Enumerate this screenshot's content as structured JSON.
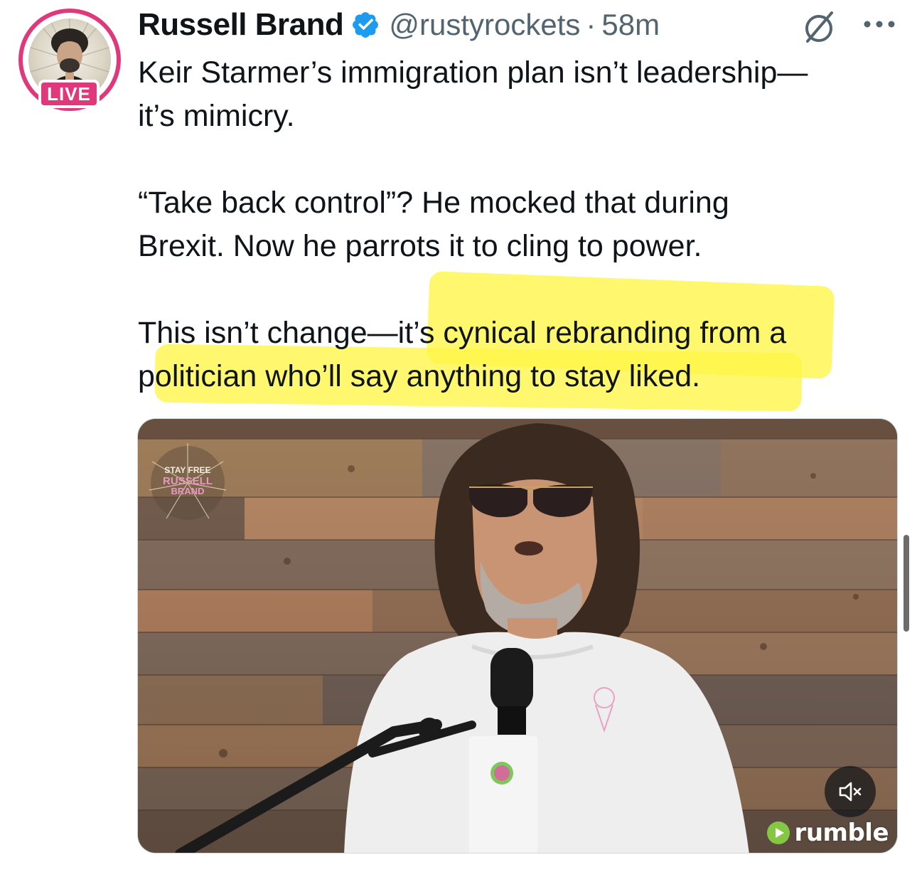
{
  "author": {
    "display_name": "Russell Brand",
    "handle": "@rustyrockets",
    "separator": "·",
    "time": "58m",
    "live_badge": "LIVE",
    "verified": true
  },
  "tweet": {
    "line1": "Keir Starmer’s immigration plan isn’t leadership—",
    "line2": "it’s mimicry.",
    "line3": "“Take back control”? He mocked that during",
    "line4": "Brexit. Now he parrots it to cling to power.",
    "line5": "This isn’t change—it’s cynical rebranding from a",
    "line6": "politician who’ll say anything to stay liked."
  },
  "media": {
    "type": "video",
    "logo_line1": "STAY FREE",
    "logo_line2": "RUSSELL",
    "logo_line3": "BRAND",
    "source_brand": "rumble",
    "muted": true
  },
  "icons": {
    "verified": "verified-badge-icon",
    "grok": "grok-icon",
    "more": "more-options-icon",
    "mute": "speaker-muted-icon"
  },
  "colors": {
    "live_ring": "#e0387b",
    "verified_blue": "#1d9bf0",
    "highlight": "#fff646",
    "rumble_green": "#85c742"
  }
}
